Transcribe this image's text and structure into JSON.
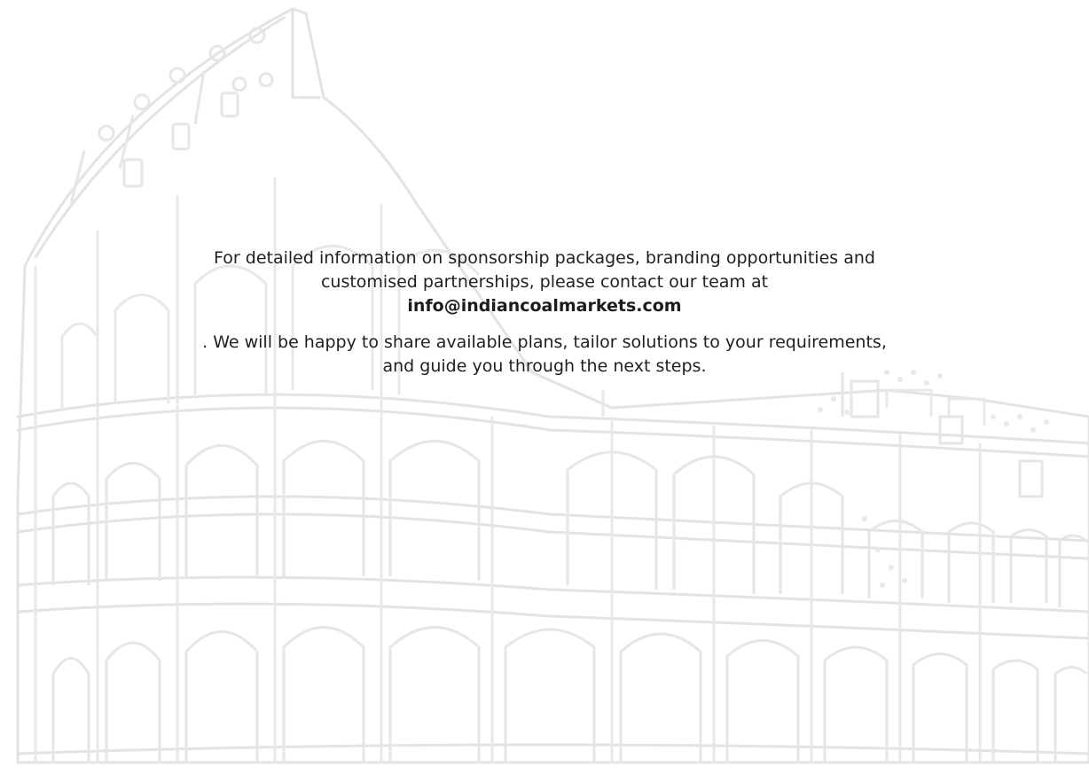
{
  "contact": {
    "intro_line_1": "For detailed information on sponsorship packages, branding opportunities and",
    "intro_line_2": "customised partnerships, please contact our team at",
    "email": "info@indiancoalmarkets.com",
    "outro_line_1": ". We will be happy to share available plans, tailor solutions to your requirements,",
    "outro_line_2": "and guide you through the next steps."
  },
  "background": {
    "icon": "colosseum-outline-illustration",
    "stroke_color": "#e4e4e4"
  }
}
